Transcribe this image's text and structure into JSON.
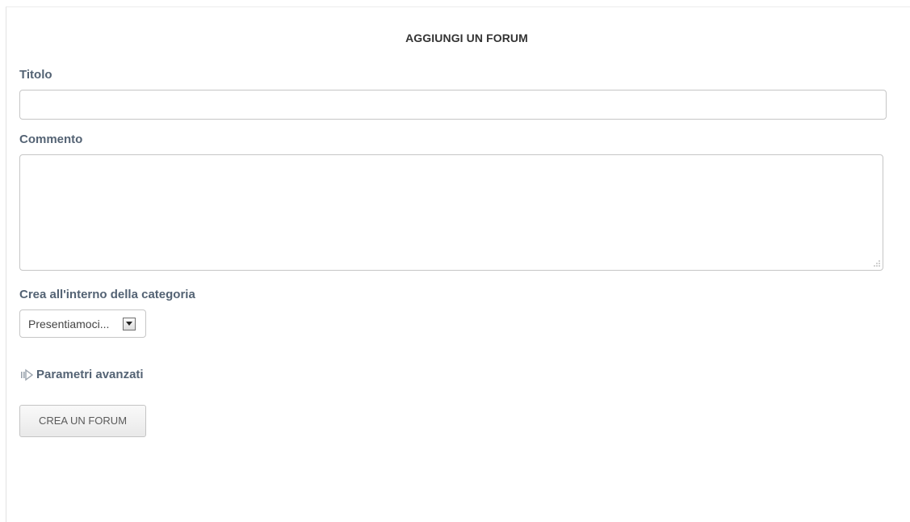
{
  "form": {
    "title": "AGGIUNGI UN FORUM",
    "fields": {
      "title_label": "Titolo",
      "title_value": "",
      "comment_label": "Commento",
      "comment_value": "",
      "category_label": "Crea all'interno della categoria",
      "category_selected": "Presentiamoci..."
    },
    "advanced_label": "Parametri avanzati",
    "submit_label": "CREA UN FORUM"
  },
  "colors": {
    "label": "#546374",
    "heading": "#333333",
    "border": "#c6c6c6"
  },
  "icons": {
    "advanced": "expand-arrow-icon",
    "select": "chevron-down-icon",
    "resize": "resize-grip-icon"
  }
}
